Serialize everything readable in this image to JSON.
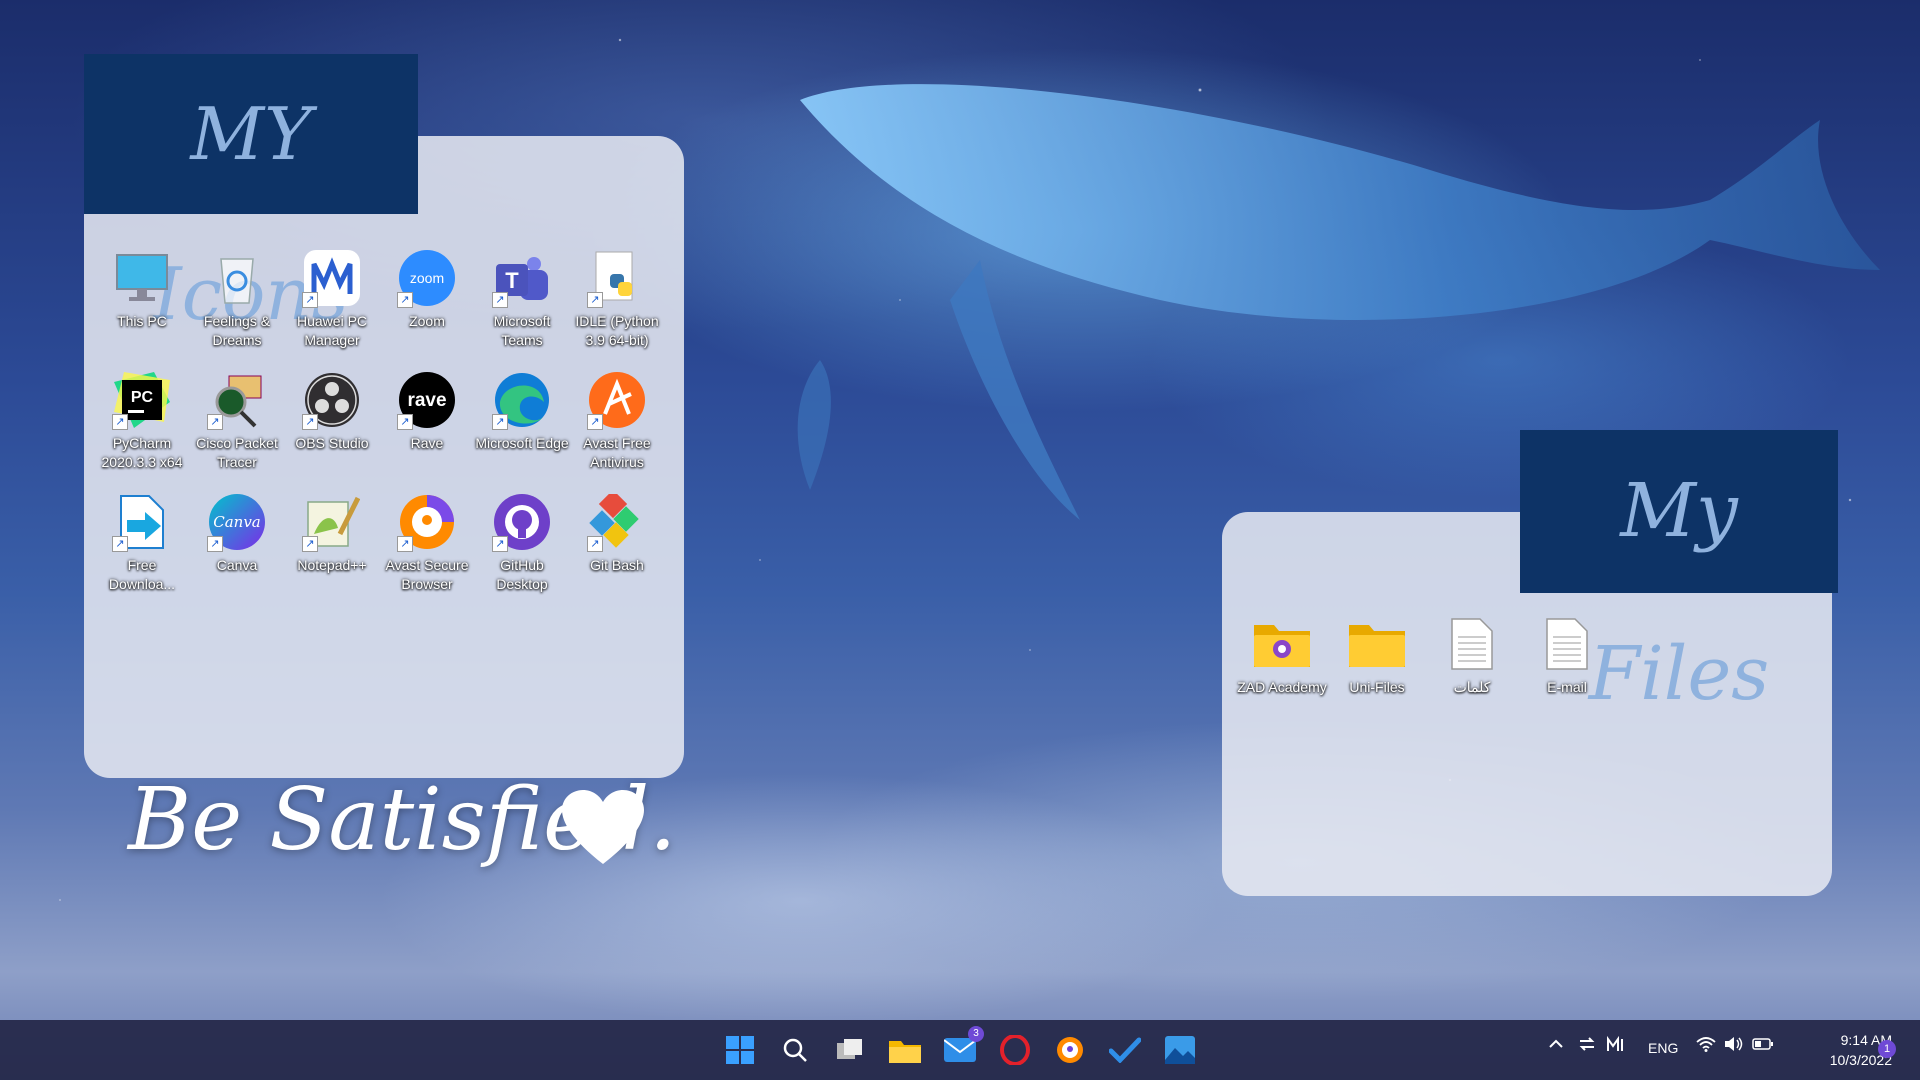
{
  "desktop": {
    "icons_title": "MY Icons",
    "files_title": "My Files",
    "quote": "Be Satisfied.",
    "icons": [
      {
        "label": "This PC",
        "icon": "this-pc-icon"
      },
      {
        "label": "Feelings & Dreams",
        "icon": "recycle-bin-icon"
      },
      {
        "label": "Huawei PC Manager",
        "icon": "huawei-pc-manager-icon"
      },
      {
        "label": "Zoom",
        "icon": "zoom-icon"
      },
      {
        "label": "Microsoft Teams",
        "icon": "teams-icon"
      },
      {
        "label": "IDLE (Python 3.9 64-bit)",
        "icon": "python-idle-icon"
      },
      {
        "label": "PyCharm 2020.3.3 x64",
        "icon": "pycharm-icon"
      },
      {
        "label": "Cisco Packet Tracer",
        "icon": "cisco-packet-tracer-icon"
      },
      {
        "label": "OBS Studio",
        "icon": "obs-studio-icon"
      },
      {
        "label": "Rave",
        "icon": "rave-icon"
      },
      {
        "label": "Microsoft Edge",
        "icon": "edge-icon"
      },
      {
        "label": "Avast Free Antivirus",
        "icon": "avast-antivirus-icon"
      },
      {
        "label": "Free Downloa...",
        "icon": "free-download-manager-icon"
      },
      {
        "label": "Canva",
        "icon": "canva-icon"
      },
      {
        "label": "Notepad++",
        "icon": "notepad-plus-plus-icon"
      },
      {
        "label": "Avast Secure Browser",
        "icon": "avast-browser-icon"
      },
      {
        "label": "GitHub Desktop",
        "icon": "github-desktop-icon"
      },
      {
        "label": "Git Bash",
        "icon": "git-bash-icon"
      }
    ],
    "files": [
      {
        "label": "ZAD Academy",
        "icon": "folder-icon"
      },
      {
        "label": "Uni-Files",
        "icon": "folder-icon"
      },
      {
        "label": "كلمات",
        "icon": "text-file-icon"
      },
      {
        "label": "E-mail",
        "icon": "text-file-icon"
      }
    ]
  },
  "taskbar": {
    "mail_badge": "3",
    "language": "ENG",
    "time": "9:14 AM",
    "date": "10/3/2022",
    "notification_badge": "1"
  }
}
